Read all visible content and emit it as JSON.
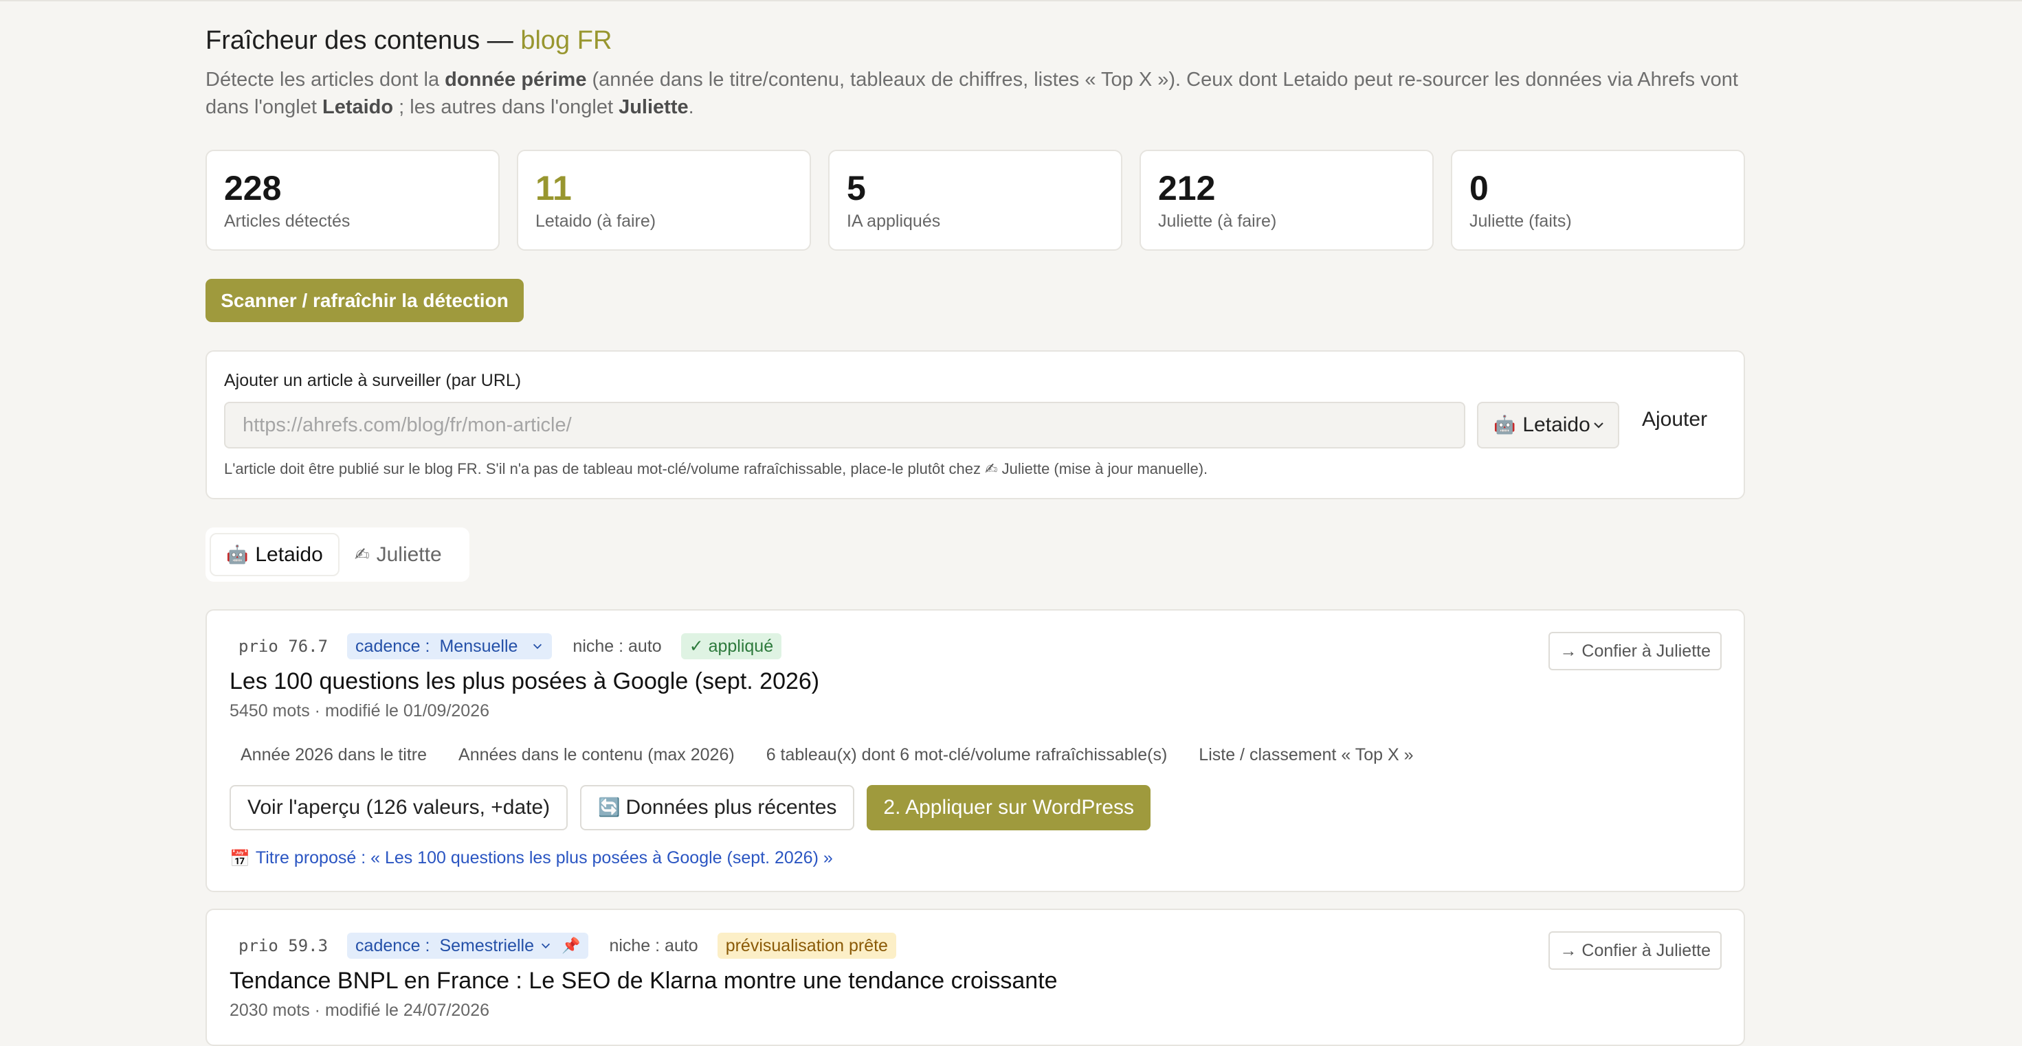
{
  "header": {
    "title_prefix": "Fraîcheur des contenus — ",
    "title_accent": "blog FR",
    "desc_1": "Détecte les articles dont la ",
    "desc_b1": "donnée périme",
    "desc_2": " (année dans le titre/contenu, tableaux de chiffres, listes « Top X »). Ceux dont Letaido peut re-sourcer les données via Ahrefs vont dans l'onglet ",
    "desc_b2": "Letaido",
    "desc_3": " ; les autres dans l'onglet ",
    "desc_b3": "Juliette",
    "desc_4": "."
  },
  "stats": [
    {
      "value": "228",
      "label": "Articles détectés"
    },
    {
      "value": "11",
      "label": "Letaido (à faire)"
    },
    {
      "value": "5",
      "label": "IA appliqués"
    },
    {
      "value": "212",
      "label": "Juliette (à faire)"
    },
    {
      "value": "0",
      "label": "Juliette (faits)"
    }
  ],
  "scan_button": "Scanner / rafraîchir la détection",
  "add": {
    "title": "Ajouter un article à surveiller (par URL)",
    "placeholder": "https://ahrefs.com/blog/fr/mon-article/",
    "select_value": "Letaido",
    "button": "Ajouter",
    "note": "L'article doit être publié sur le blog FR. S'il n'a pas de tableau mot-clé/volume rafraîchissable, place-le plutôt chez ✍ Juliette (mise à jour manuelle)."
  },
  "tabs": [
    {
      "label": "Letaido",
      "icon": "robot-icon"
    },
    {
      "label": "Juliette",
      "icon": "writing-hand-icon"
    }
  ],
  "articles": [
    {
      "prio": "prio 76.7",
      "cadence_label": "cadence :",
      "cadence_value": "Mensuelle",
      "niche": "niche : auto",
      "status": "✓ appliqué",
      "confier": "→ Confier à Juliette",
      "title": "Les 100 questions les plus posées à Google (sept. 2026)",
      "meta": "5450 mots · modifié le 01/09/2026",
      "reasons": [
        "Année 2026 dans le titre",
        "Années dans le contenu (max 2026)",
        "6 tableau(x) dont 6 mot-clé/volume rafraîchissable(s)",
        "Liste / classement « Top X »"
      ],
      "btn_preview": "Voir l'aperçu (126 valeurs, +date)",
      "btn_recent": "Données plus récentes",
      "btn_apply": "2. Appliquer sur WordPress",
      "proposed": "Titre proposé : « Les 100 questions les plus posées à Google (sept. 2026) »"
    },
    {
      "prio": "prio 59.3",
      "cadence_label": "cadence :",
      "cadence_value": "Semestrielle",
      "niche": "niche : auto",
      "status": "prévisualisation prête",
      "confier": "→ Confier à Juliette",
      "title": "Tendance BNPL en France : Le SEO de Klarna montre une tendance croissante",
      "meta": "2030 mots · modifié le 24/07/2026"
    }
  ]
}
